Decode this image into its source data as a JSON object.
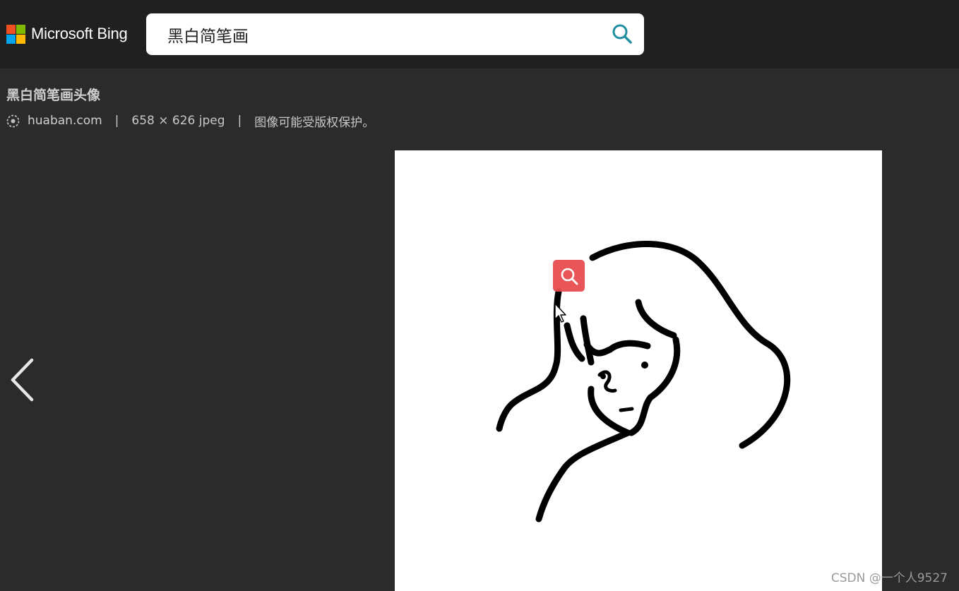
{
  "header": {
    "brand": "Microsoft Bing",
    "logo_colors": [
      "#f25022",
      "#7fba00",
      "#00a4ef",
      "#ffb900"
    ],
    "search_value": "黑白简笔画",
    "search_icon": "search-icon"
  },
  "result": {
    "title": "黑白简笔画头像",
    "source": "huaban.com",
    "separator": "|",
    "dimensions": "658 × 626 jpeg",
    "copyright": "图像可能受版权保护。"
  },
  "viewer": {
    "prev_icon": "chevron-left-icon",
    "visual_search_icon": "visual-search-icon",
    "visual_search_color": "#e84e52"
  },
  "watermark": "CSDN @一个人9527"
}
